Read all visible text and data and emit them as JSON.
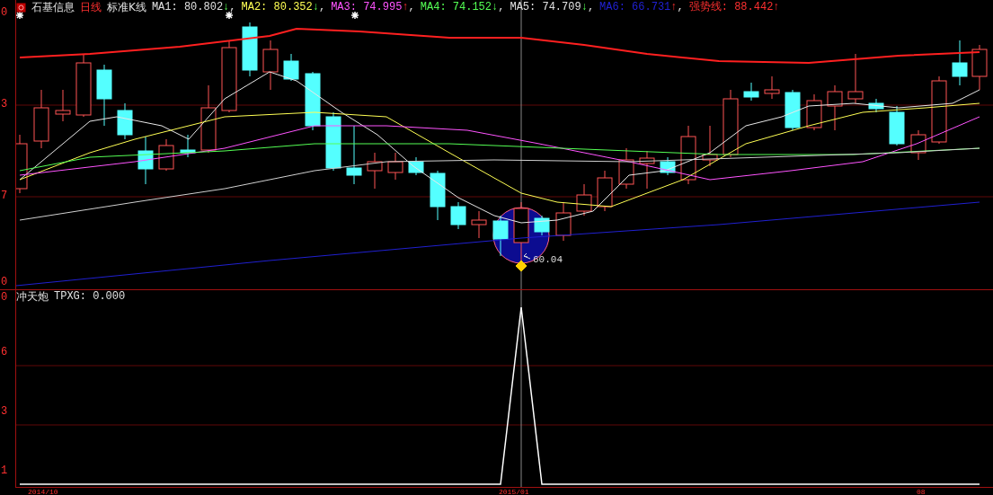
{
  "header": {
    "stock": "石基信息",
    "period": "日线",
    "chart_type": "标准K线",
    "indicators": [
      {
        "name": "MA1:",
        "value": "80.802",
        "kind": "down",
        "arrow": "↓",
        "color": "#e0e0e0",
        "separator": ","
      },
      {
        "name": "MA2:",
        "value": "80.352",
        "kind": "down",
        "arrow": "↓",
        "color": "#ffff54",
        "separator": ","
      },
      {
        "name": "MA3:",
        "value": "74.995",
        "kind": "up",
        "arrow": "↑",
        "color": "#ff54ff",
        "separator": ","
      },
      {
        "name": "MA4:",
        "value": "74.152",
        "kind": "down",
        "arrow": "↓",
        "color": "#54ff54",
        "separator": ","
      },
      {
        "name": "MA5:",
        "value": "74.709",
        "kind": "down",
        "arrow": "↓",
        "color": "#e0e0e0",
        "separator": ","
      },
      {
        "name": "MA6:",
        "value": "66.731",
        "kind": "up",
        "arrow": "↑",
        "color": "#2020d0",
        "separator": ","
      },
      {
        "name": "强势线:",
        "value": "88.442",
        "kind": "up",
        "arrow": "↑",
        "color": "#ff3030"
      }
    ]
  },
  "price_axis": {
    "labels": [
      "0",
      "3",
      "7",
      "0"
    ]
  },
  "annotation": {
    "label": "60.04"
  },
  "indicator_panel": {
    "title": "冲天炮",
    "reading": "TPXG: 0.000"
  },
  "indicator_axis": {
    "labels": [
      "0",
      "6",
      "3",
      "1"
    ]
  },
  "date_axis": {
    "labels": [
      "2014/10",
      "2015/01",
      "08"
    ]
  }
}
